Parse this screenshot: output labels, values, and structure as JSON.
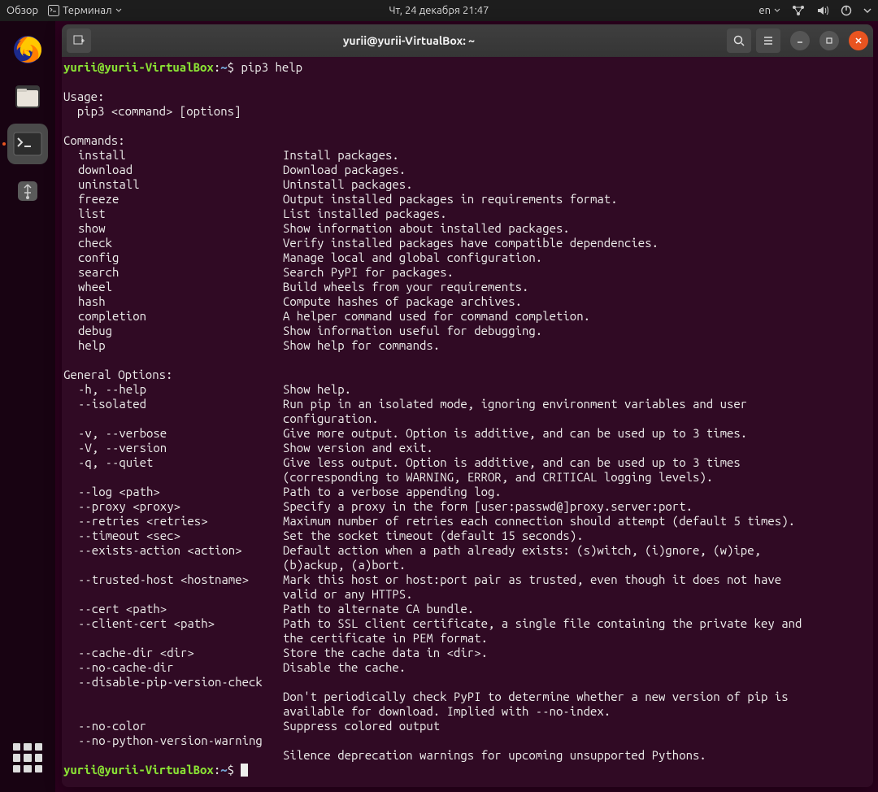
{
  "top": {
    "overview": "Обзор",
    "app_menu": "Терминал",
    "datetime": "Чт, 24 декабря  21:47",
    "lang": "en"
  },
  "titlebar": {
    "title": "yurii@yurii-VirtualBox: ~"
  },
  "prompt": {
    "user_host": "yurii@yurii-VirtualBox",
    "path": "~",
    "command": "pip3 help"
  },
  "usage_header": "Usage:",
  "usage_line": "  pip3 <command> [options]",
  "commands_header": "Commands:",
  "commands": [
    {
      "name": "install",
      "desc": "Install packages."
    },
    {
      "name": "download",
      "desc": "Download packages."
    },
    {
      "name": "uninstall",
      "desc": "Uninstall packages."
    },
    {
      "name": "freeze",
      "desc": "Output installed packages in requirements format."
    },
    {
      "name": "list",
      "desc": "List installed packages."
    },
    {
      "name": "show",
      "desc": "Show information about installed packages."
    },
    {
      "name": "check",
      "desc": "Verify installed packages have compatible dependencies."
    },
    {
      "name": "config",
      "desc": "Manage local and global configuration."
    },
    {
      "name": "search",
      "desc": "Search PyPI for packages."
    },
    {
      "name": "wheel",
      "desc": "Build wheels from your requirements."
    },
    {
      "name": "hash",
      "desc": "Compute hashes of package archives."
    },
    {
      "name": "completion",
      "desc": "A helper command used for command completion."
    },
    {
      "name": "debug",
      "desc": "Show information useful for debugging."
    },
    {
      "name": "help",
      "desc": "Show help for commands."
    }
  ],
  "options_header": "General Options:",
  "options": [
    {
      "name": "-h, --help",
      "desc": [
        "Show help."
      ]
    },
    {
      "name": "--isolated",
      "desc": [
        "Run pip in an isolated mode, ignoring environment variables and user",
        "configuration."
      ]
    },
    {
      "name": "-v, --verbose",
      "desc": [
        "Give more output. Option is additive, and can be used up to 3 times."
      ]
    },
    {
      "name": "-V, --version",
      "desc": [
        "Show version and exit."
      ]
    },
    {
      "name": "-q, --quiet",
      "desc": [
        "Give less output. Option is additive, and can be used up to 3 times",
        "(corresponding to WARNING, ERROR, and CRITICAL logging levels)."
      ]
    },
    {
      "name": "--log <path>",
      "desc": [
        "Path to a verbose appending log."
      ]
    },
    {
      "name": "--proxy <proxy>",
      "desc": [
        "Specify a proxy in the form [user:passwd@]proxy.server:port."
      ]
    },
    {
      "name": "--retries <retries>",
      "desc": [
        "Maximum number of retries each connection should attempt (default 5 times)."
      ]
    },
    {
      "name": "--timeout <sec>",
      "desc": [
        "Set the socket timeout (default 15 seconds)."
      ]
    },
    {
      "name": "--exists-action <action>",
      "desc": [
        "Default action when a path already exists: (s)witch, (i)gnore, (w)ipe,",
        "(b)ackup, (a)bort."
      ]
    },
    {
      "name": "--trusted-host <hostname>",
      "desc": [
        "Mark this host or host:port pair as trusted, even though it does not have",
        "valid or any HTTPS."
      ]
    },
    {
      "name": "--cert <path>",
      "desc": [
        "Path to alternate CA bundle."
      ]
    },
    {
      "name": "--client-cert <path>",
      "desc": [
        "Path to SSL client certificate, a single file containing the private key and",
        "the certificate in PEM format."
      ]
    },
    {
      "name": "--cache-dir <dir>",
      "desc": [
        "Store the cache data in <dir>."
      ]
    },
    {
      "name": "--no-cache-dir",
      "desc": [
        "Disable the cache."
      ]
    },
    {
      "name": "--disable-pip-version-check",
      "desc": [
        "",
        "Don't periodically check PyPI to determine whether a new version of pip is",
        "available for download. Implied with --no-index."
      ]
    },
    {
      "name": "--no-color",
      "desc": [
        "Suppress colored output"
      ]
    },
    {
      "name": "--no-python-version-warning",
      "desc": [
        "",
        "Silence deprecation warnings for upcoming unsupported Pythons."
      ]
    }
  ]
}
